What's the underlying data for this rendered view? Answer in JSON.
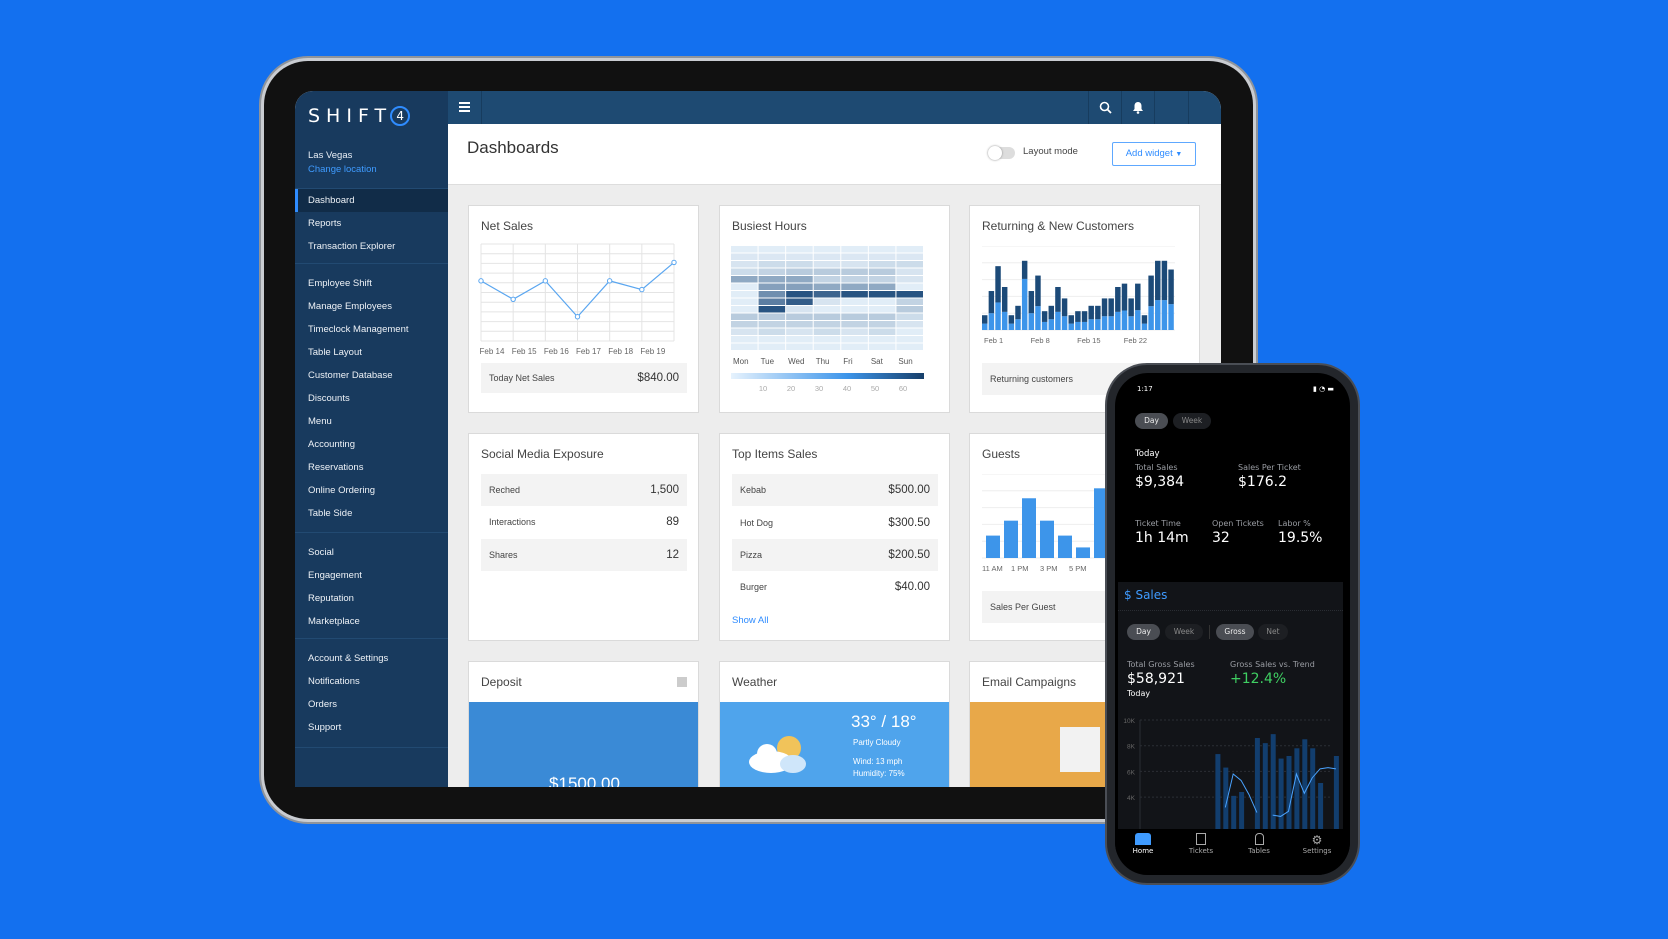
{
  "sidebar": {
    "logo": "SHIFT4",
    "location": "Las Vegas",
    "change_location": "Change location",
    "groups": [
      [
        "Dashboard",
        "Reports",
        "Transaction Explorer"
      ],
      [
        "Employee Shift",
        "Manage Employees",
        "Timeclock Management",
        "Table Layout",
        "Customer Database",
        "Discounts",
        "Menu",
        "Accounting",
        "Reservations",
        "Online Ordering",
        "Table Side"
      ],
      [
        "Social",
        "Engagement",
        "Reputation",
        "Marketplace"
      ],
      [
        "Account & Settings",
        "Notifications",
        "Orders",
        "Support"
      ]
    ],
    "active": "Dashboard"
  },
  "topbar": {
    "icons": [
      "menu-icon",
      "search-icon",
      "bell-icon"
    ]
  },
  "header": {
    "title": "Dashboards",
    "layout_mode": "Layout mode",
    "layout_mode_on": false,
    "add_widget": "Add widget"
  },
  "cards": {
    "net_sales": {
      "title": "Net Sales",
      "footer_label": "Today Net Sales",
      "footer_value": "$840.00"
    },
    "busiest_hours": {
      "title": "Busiest Hours"
    },
    "returning": {
      "title": "Returning & New Customers",
      "footer_label": "Returning customers"
    },
    "social": {
      "title": "Social Media Exposure",
      "rows": [
        {
          "label": "Reched",
          "value": "1,500"
        },
        {
          "label": "Interactions",
          "value": "89"
        },
        {
          "label": "Shares",
          "value": "12"
        }
      ]
    },
    "top_items": {
      "title": "Top Items Sales",
      "rows": [
        {
          "label": "Kebab",
          "value": "$500.00"
        },
        {
          "label": "Hot Dog",
          "value": "$300.50"
        },
        {
          "label": "Pizza",
          "value": "$200.50"
        },
        {
          "label": "Burger",
          "value": "$40.00"
        }
      ],
      "show_all": "Show All"
    },
    "guests": {
      "title": "Guests",
      "footer_label": "Sales Per Guest"
    },
    "deposit": {
      "title": "Deposit",
      "value": "$1500.00",
      "color": "#3a8ad6"
    },
    "weather": {
      "title": "Weather",
      "temp": "33° / 18°",
      "condition": "Partly Cloudy",
      "wind": "Wind: 13 mph",
      "humidity": "Humidity: 75%",
      "color": "#4fa4ec"
    },
    "email": {
      "title": "Email Campaigns",
      "color": "#e8a849"
    }
  },
  "chart_data": [
    {
      "type": "line",
      "title": "Net Sales",
      "categories": [
        "Feb 14",
        "Feb 15",
        "Feb 16",
        "Feb 17",
        "Feb 18",
        "Feb 19",
        ""
      ],
      "values": [
        62,
        43,
        62,
        25,
        62,
        53,
        81
      ],
      "ylim": [
        0,
        100
      ],
      "grid": true
    },
    {
      "type": "heatmap",
      "title": "Busiest Hours",
      "categories": [
        "Mon",
        "Tue",
        "Wed",
        "Thu",
        "Fri",
        "Sat",
        "Sun"
      ],
      "values": [
        [
          0.05,
          0.05,
          0.05,
          0.05,
          0.05,
          0.05,
          0.05
        ],
        [
          0.08,
          0.08,
          0.08,
          0.08,
          0.08,
          0.08,
          0.08
        ],
        [
          0.1,
          0.15,
          0.15,
          0.1,
          0.1,
          0.15,
          0.15
        ],
        [
          0.15,
          0.2,
          0.25,
          0.25,
          0.25,
          0.25,
          0.1
        ],
        [
          0.45,
          0.45,
          0.45,
          0.2,
          0.2,
          0.2,
          0.1
        ],
        [
          0.05,
          0.5,
          0.5,
          0.45,
          0.45,
          0.45,
          0.05
        ],
        [
          0.05,
          0.6,
          0.95,
          0.85,
          0.95,
          0.95,
          0.95
        ],
        [
          0.05,
          0.7,
          0.9,
          0.1,
          0.05,
          0.05,
          0.2
        ],
        [
          0.05,
          0.95,
          0.1,
          0.05,
          0.05,
          0.05,
          0.25
        ],
        [
          0.25,
          0.25,
          0.25,
          0.25,
          0.25,
          0.25,
          0.15
        ],
        [
          0.2,
          0.2,
          0.2,
          0.2,
          0.2,
          0.2,
          0.1
        ],
        [
          0.1,
          0.15,
          0.1,
          0.15,
          0.1,
          0.15,
          0.05
        ],
        [
          0.05,
          0.05,
          0.05,
          0.05,
          0.05,
          0.05,
          0.05
        ],
        [
          0.05,
          0.05,
          0.05,
          0.05,
          0.05,
          0.05,
          0.05
        ]
      ],
      "colorbar_ticks": [
        "10",
        "20",
        "30",
        "40",
        "50",
        "60"
      ]
    },
    {
      "type": "bar",
      "title": "Returning & New Customers",
      "x_ticks": [
        "Feb 1",
        "Feb 8",
        "Feb 15",
        "Feb 22"
      ],
      "stacked": true,
      "series": [
        {
          "values": [
            19,
            50,
            82,
            54,
            19,
            32,
            152,
            50,
            71,
            24,
            32,
            54,
            41,
            19,
            24,
            24,
            32,
            32,
            41,
            41,
            54,
            58,
            41,
            59,
            19,
            71,
            89,
            89,
            77
          ],
          "color": "#3d95ea"
        },
        {
          "values": [
            25,
            66,
            108,
            74,
            25,
            40,
            54,
            66,
            91,
            32,
            40,
            74,
            53,
            25,
            32,
            32,
            40,
            40,
            53,
            53,
            74,
            80,
            53,
            79,
            25,
            91,
            117,
            117,
            103
          ],
          "color": "#1c4a78"
        }
      ],
      "ylim": [
        0,
        250
      ]
    },
    {
      "type": "bar",
      "title": "Guests",
      "x_ticks": [
        "11 AM",
        "1 PM",
        "3 PM",
        "5 PM"
      ],
      "values": [
        72,
        120,
        192,
        120,
        72,
        34,
        224
      ],
      "ylim": [
        0,
        270
      ]
    },
    {
      "type": "bar+line",
      "title": "$ Sales",
      "y_ticks": [
        "10K",
        "8K",
        "6K",
        "4K"
      ],
      "ylim": [
        3000,
        10000
      ],
      "bars": [
        null,
        null,
        null,
        null,
        null,
        null,
        7350,
        6300,
        4100,
        4400,
        null,
        8600,
        8200,
        8900,
        7000,
        7200,
        7800,
        8500,
        7800,
        5100,
        null,
        7200
      ],
      "line": [
        null,
        null,
        null,
        null,
        null,
        null,
        null,
        3200,
        5800,
        5300,
        4200,
        2800,
        null,
        2600,
        2500,
        2900,
        5800,
        4300,
        5500,
        6200,
        6300,
        6200
      ]
    }
  ],
  "phone": {
    "time": "1:17",
    "period_tabs": [
      "Day",
      "Week"
    ],
    "today": "Today",
    "total_sales_label": "Total Sales",
    "total_sales": "$9,384",
    "spt_label": "Sales Per Ticket",
    "spt": "$176.2",
    "ticket_time_label": "Ticket Time",
    "ticket_time": "1h 14m",
    "open_tickets_label": "Open Tickets",
    "open_tickets": "32",
    "labor_label": "Labor %",
    "labor": "19.5%",
    "sales_title": "$ Sales",
    "sales_tabs": [
      "Day",
      "Week",
      "Gross",
      "Net"
    ],
    "gross_label": "Total Gross Sales",
    "gross": "$58,921",
    "gross_sub": "Today",
    "trend_label": "Gross Sales vs. Trend",
    "trend": "+12.4%",
    "trend_color": "#3fcf62",
    "nav": [
      "Home",
      "Tickets",
      "Tables",
      "Settings"
    ]
  }
}
